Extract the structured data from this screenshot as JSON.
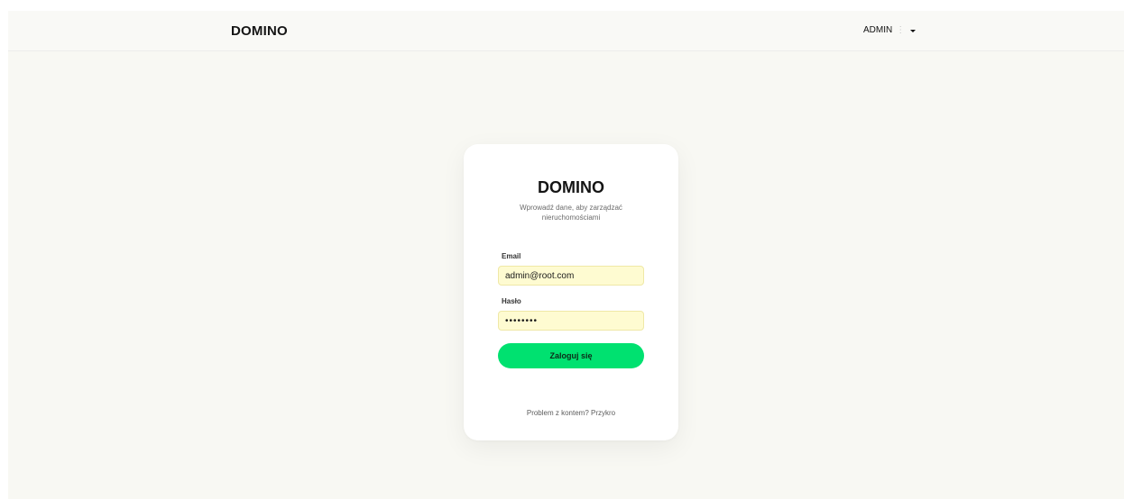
{
  "topbar": {
    "brand": "DOMINO",
    "user_name": "ADMIN",
    "separator": "⋮"
  },
  "login_card": {
    "title": "DOMINO",
    "subtitle": "Wprowadź dane, aby zarządzać nieruchomościami",
    "email_label": "Email",
    "email_value": "admin@root.com",
    "password_label": "Hasło",
    "password_value": "password",
    "submit_label": "Zaloguj się",
    "help_prefix": "Problem z kontem?",
    "help_link": "Przykro"
  },
  "colors": {
    "page_bg": "#f8f8f3",
    "card_bg": "#ffffff",
    "input_autofill_bg": "#fefbd1",
    "primary_button": "#00e170"
  },
  "icons": {
    "user_menu": "caret-down-icon"
  }
}
